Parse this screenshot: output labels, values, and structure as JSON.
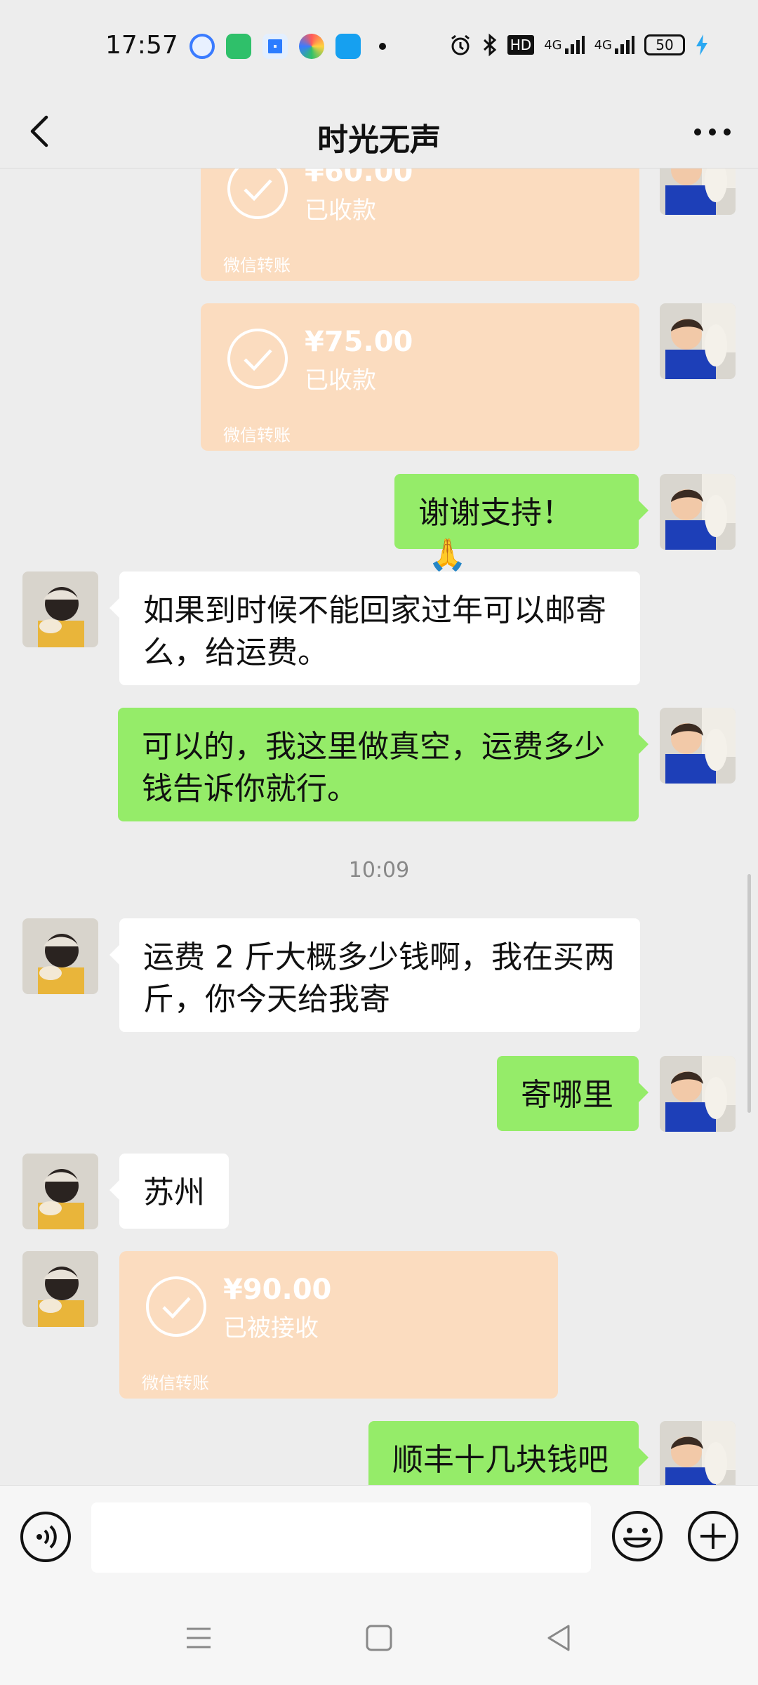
{
  "status_bar": {
    "time": "17:57",
    "hd": "HD",
    "net1": "4G",
    "net2": "4G",
    "battery": "50"
  },
  "nav": {
    "title": "时光无声"
  },
  "messages": {
    "transfer1": {
      "amount": "¥60.00",
      "status": "已收款",
      "label": "微信转账"
    },
    "transfer2": {
      "amount": "¥75.00",
      "status": "已收款",
      "label": "微信转账"
    },
    "msg1": "谢谢支持！",
    "msg1_emoji": "🙏",
    "msg2": "如果到时候不能回家过年可以邮寄么，给运费。",
    "msg3": "可以的，我这里做真空，运费多少钱告诉你就行。",
    "timestamp": "10:09",
    "msg4": "运费 2 斤大概多少钱啊，我在买两斤，你今天给我寄",
    "msg5": "寄哪里",
    "msg6": "苏州",
    "transfer3": {
      "amount": "¥90.00",
      "status": "已被接收",
      "label": "微信转账"
    },
    "msg7": "顺丰十几块钱吧"
  },
  "input": {
    "placeholder": ""
  },
  "colors": {
    "sent_bubble": "#95ec69",
    "received_bubble": "#ffffff",
    "transfer_bg": "#fbdcbf",
    "background": "#ededed"
  },
  "icons": {
    "back": "chevron-left-icon",
    "more": "more-dots-icon",
    "voice": "voice-icon",
    "emoji": "emoji-icon",
    "plus": "plus-icon"
  }
}
